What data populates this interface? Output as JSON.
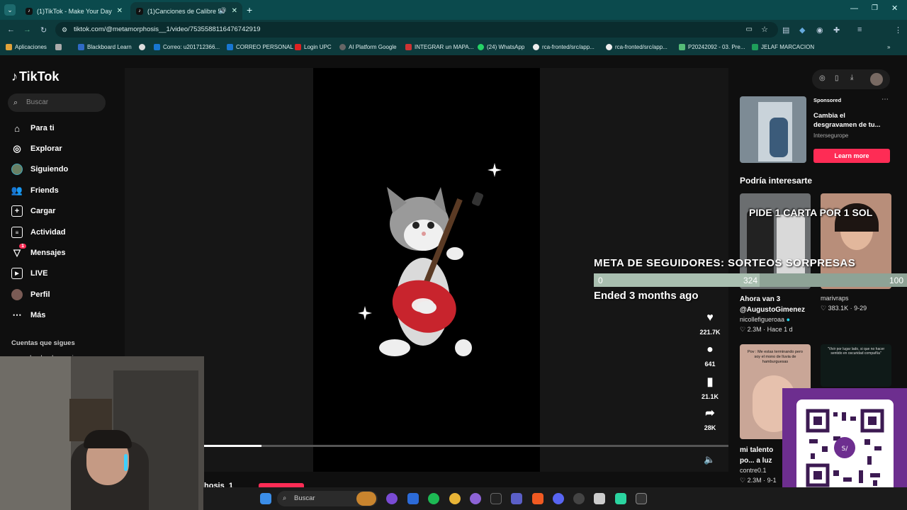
{
  "browser": {
    "tabs": [
      {
        "title": "(1)TikTok - Make Your Day"
      },
      {
        "title": "(1)Canciones de Calibre 50"
      }
    ],
    "url": "tiktok.com/@metamorphosis__1/video/7535588116476742919",
    "bookmarks": [
      "Aplicaciones",
      "Blackboard Learn",
      "Correo: u201712366...",
      "CORREO PERSONAL",
      "Login UPC",
      "AI Platform Google",
      "INTEGRAR un MAPA...",
      "(24) WhatsApp",
      "rca-fronted/src/app...",
      "rca-fronted/src/app...",
      "P20242092 - 03. Pre...",
      "JELAF MARCACION"
    ]
  },
  "tiktok": {
    "logo": "TikTok",
    "search_placeholder": "Buscar",
    "nav": [
      "Para ti",
      "Explorar",
      "Siguiendo",
      "Friends",
      "Cargar",
      "Actividad",
      "Mensajes",
      "LIVE",
      "Perfil",
      "Más"
    ],
    "messages_badge": "1",
    "following_heading": "Cuentas que sigues",
    "following_partial": "Locke de magia",
    "video": {
      "likes": "221.7K",
      "comments": "641",
      "saves": "21.1K",
      "shares": "28K",
      "author_partial": "hosis_1",
      "progress": 0.11
    },
    "sponsored": {
      "label": "Sponsored",
      "title": "Cambia el desgravamen de tu...",
      "advertiser": "Intersegurope",
      "cta": "Learn more"
    },
    "suggest_heading": "Podría interesarte",
    "suggestions": [
      {
        "title": "Ahora van 3 @AugustoGimenez",
        "author": "nicollefigueroaa",
        "likes": "2.3M",
        "age": "Hace 1 d"
      },
      {
        "title": "marivraps",
        "author": "",
        "likes": "383.1K",
        "age": "9-29"
      },
      {
        "title": "mi talento po... a luz #fyp #c...",
        "author": "contre0.1",
        "likes": "2.3M",
        "age": "9-1"
      },
      {
        "title": "",
        "author": "",
        "likes": "",
        "age": ""
      }
    ],
    "thumb_text": "Pov : Me estas terminando pero soy el mono de lluvia de hamburguesas",
    "thumb_text2": "\"Vivir por lugar lado, si que no hacer sentido en oscuridad compañía\""
  },
  "stream_overlay": {
    "banner": "PIDE 1 CARTA POR 1 SOL",
    "goal_title": "META DE SEGUIDORES: SORTEOS SORPRESAS",
    "goal_start": "0",
    "goal_current": "324",
    "goal_target": "100",
    "goal_fraction": 0.53,
    "ended": "Ended 3 months ago"
  },
  "taskbar": {
    "search_placeholder": "Buscar"
  },
  "colors": {
    "tiktok_red": "#fe2c55",
    "chrome_teal": "#0b4a4d",
    "yape_purple": "#6d2e8f"
  }
}
